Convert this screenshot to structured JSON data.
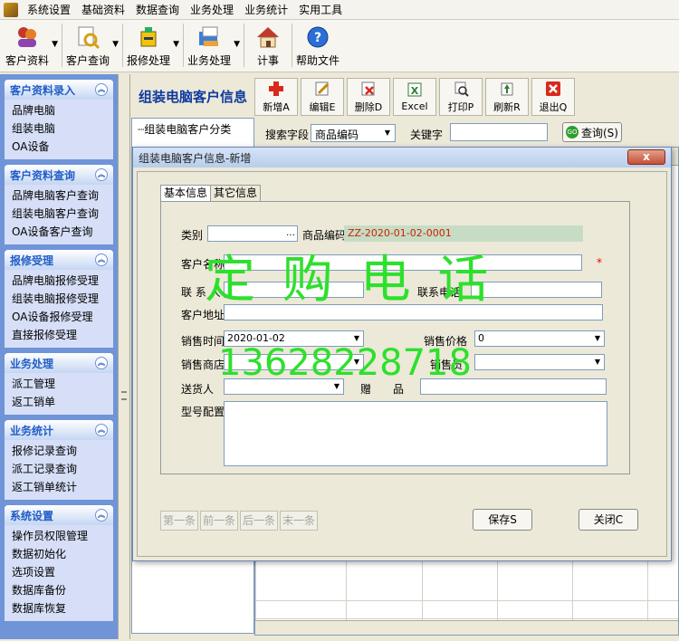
{
  "menu": [
    "系统设置",
    "基础资料",
    "数据查询",
    "业务处理",
    "业务统计",
    "实用工具"
  ],
  "toolbar": [
    {
      "label": "客户资料",
      "icon": "users-icon",
      "arrow": true
    },
    {
      "label": "客户查询",
      "icon": "document-search-icon",
      "arrow": true
    },
    {
      "label": "报修处理",
      "icon": "repair-icon",
      "arrow": true
    },
    {
      "label": "业务处理",
      "icon": "business-icon",
      "arrow": true
    },
    {
      "label": "计事",
      "icon": "home-icon",
      "arrow": false
    },
    {
      "label": "帮助文件",
      "icon": "help-icon",
      "arrow": false
    }
  ],
  "sidebar": [
    {
      "title": "客户资料录入",
      "items": [
        "品牌电脑",
        "组装电脑",
        "OA设备"
      ]
    },
    {
      "title": "客户资料查询",
      "items": [
        "品牌电脑客户查询",
        "组装电脑客户查询",
        "OA设备客户查询"
      ]
    },
    {
      "title": "报修受理",
      "items": [
        "品牌电脑报修受理",
        "组装电脑报修受理",
        "OA设备报修受理",
        "直接报修受理"
      ]
    },
    {
      "title": "业务处理",
      "items": [
        "派工管理",
        "返工销单"
      ]
    },
    {
      "title": "业务统计",
      "items": [
        "报修记录查询",
        "派工记录查询",
        "返工销单统计"
      ]
    },
    {
      "title": "系统设置",
      "items": [
        "操作员权限管理",
        "数据初始化",
        "选项设置",
        "数据库备份",
        "数据库恢复"
      ]
    }
  ],
  "main": {
    "title": "组装电脑客户信息",
    "buttons": [
      {
        "label": "新增A",
        "icon": "add-icon"
      },
      {
        "label": "编辑E",
        "icon": "edit-icon"
      },
      {
        "label": "删除D",
        "icon": "delete-icon"
      },
      {
        "label": "Excel",
        "icon": "excel-icon"
      },
      {
        "label": "打印P",
        "icon": "print-icon"
      },
      {
        "label": "刷新R",
        "icon": "refresh-icon"
      },
      {
        "label": "退出Q",
        "icon": "exit-icon"
      }
    ],
    "tree_node": "组装电脑客户分类",
    "search_label": "搜索字段",
    "search_value": "商品编码",
    "keyword_label": "关键字",
    "query_label": "查询(S)"
  },
  "dialog": {
    "title": "组装电脑客户信息-新增",
    "close": "x",
    "tabs": [
      "基本信息",
      "其它信息"
    ],
    "fields": {
      "category_label": "类别",
      "product_code_label": "商品编码",
      "product_code_value": "ZZ-2020-01-02-0001",
      "customer_name_label": "客户名称",
      "contact_label": "联 系 人",
      "phone_label": "联系电话",
      "address_label": "客户地址",
      "sale_time_label": "销售时间",
      "sale_time_value": "2020-01-02",
      "price_label": "销售价格",
      "price_value": "0",
      "store_label": "销售商店",
      "salesman_label": "销售员",
      "delivery_label": "送货人",
      "gift_label": "赠　　品",
      "config_label": "型号配置"
    },
    "nav": [
      "第一条",
      "前一条",
      "后一条",
      "末一条"
    ],
    "save": "保存S",
    "close_btn": "关闭C"
  },
  "watermark": {
    "line1": "定 购 电 话",
    "line2": "13628228718"
  },
  "colors": {
    "accent": "#0f3a9e",
    "sidebar_bg": "#6f94d8",
    "watermark": "#2de02d",
    "code": "#cc2200"
  }
}
